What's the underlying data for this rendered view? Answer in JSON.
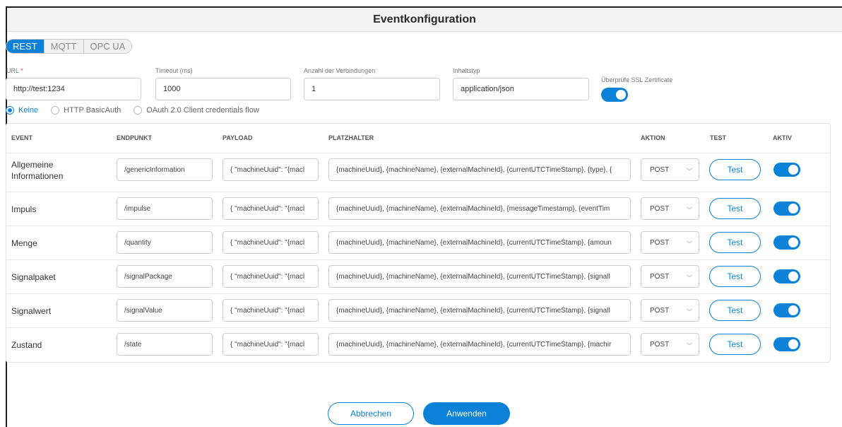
{
  "dialog": {
    "title": "Eventkonfiguration"
  },
  "protocols": [
    {
      "label": "REST",
      "active": true
    },
    {
      "label": "MQTT",
      "active": false
    },
    {
      "label": "OPC UA",
      "active": false
    }
  ],
  "fields": {
    "url": {
      "label": "URL",
      "required_mark": "*",
      "value": "http://test:1234"
    },
    "timeout": {
      "label": "Timeout (ms)",
      "value": "1000"
    },
    "connections": {
      "label": "Anzahl der Verbindungen",
      "value": "1"
    },
    "content_type": {
      "label": "Inhaltstyp",
      "value": "application/json"
    },
    "ssl": {
      "label": "Überprüfe SSL Zertificate",
      "enabled": true
    }
  },
  "auth": {
    "options": [
      "Keine",
      "HTTP BasicAuth",
      "OAuth 2.0 Client credentials flow"
    ],
    "selected": "Keine"
  },
  "table": {
    "headers": {
      "event": "EVENT",
      "endpoint": "ENDPUNKT",
      "payload": "PAYLOAD",
      "placeholder": "PLATZHALTER",
      "action": "AKTION",
      "test": "TEST",
      "active": "AKTIV"
    },
    "test_label": "Test",
    "rows": [
      {
        "event": "Allgemeine Informationen",
        "endpoint": "/genericInformation",
        "payload": "{  \"machineUuid\": \"{macl",
        "placeholders": "{machineUuid}, {machineName}, {externalMachineId}, {currentUTCTimeStamp}, {type}, {",
        "action": "POST",
        "active": true
      },
      {
        "event": "Impuls",
        "endpoint": "/impulse",
        "payload": "{  \"machineUuid\": \"{macl",
        "placeholders": "{machineUuid}, {machineName}, {externalMachineId}, {messageTimestamp}, {eventTim",
        "action": "POST",
        "active": true
      },
      {
        "event": "Menge",
        "endpoint": "/quantity",
        "payload": "{  \"machineUuid\": \"{macl",
        "placeholders": "{machineUuid}, {machineName}, {externalMachineId}, {currentUTCTimeStamp}, {amoun",
        "action": "POST",
        "active": true
      },
      {
        "event": "Signalpaket",
        "endpoint": "/signalPackage",
        "payload": "{  \"machineUuid\": \"{macl",
        "placeholders": "{machineUuid}, {machineName}, {externalMachineId}, {currentUTCTimeStamp}, {signalI",
        "action": "POST",
        "active": true
      },
      {
        "event": "Signalwert",
        "endpoint": "/signalValue",
        "payload": "{  \"machineUuid\": \"{macl",
        "placeholders": "{machineUuid}, {machineName}, {externalMachineId}, {currentUTCTimeStamp}, {signalI",
        "action": "POST",
        "active": true
      },
      {
        "event": "Zustand",
        "endpoint": "/state",
        "payload": "{  \"machineUuid\": \"{macl",
        "placeholders": "{machineUuid}, {machineName}, {externalMachineId}, {currentUTCTimeStamp}, {machir",
        "action": "POST",
        "active": true
      }
    ]
  },
  "footer": {
    "cancel_label": "Abbrechen",
    "apply_label": "Anwenden"
  },
  "colors": {
    "accent": "#0b82d8"
  }
}
